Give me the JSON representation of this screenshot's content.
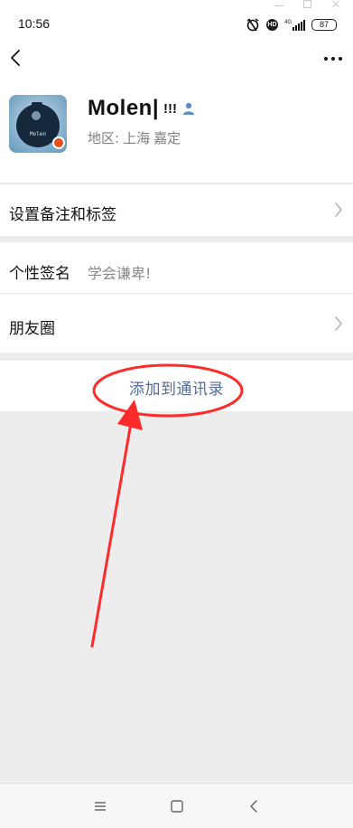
{
  "status_bar": {
    "time": "10:56",
    "hd_label": "HD",
    "network_label": "4G",
    "battery": "87"
  },
  "profile": {
    "avatar_text": "Molen",
    "name": "Molen|",
    "name_extra": "!!!",
    "region_label": "地区:",
    "region_city": "上海",
    "region_district": "嘉定"
  },
  "menu": {
    "remark_tags": "设置备注和标签",
    "signature_label": "个性签名",
    "signature_value": "学会谦卑!",
    "moments": "朋友圈",
    "add_contact": "添加到通讯录"
  },
  "colors": {
    "link": "#576b95",
    "annotation": "#ff2b2b",
    "background": "#ededed"
  },
  "icons": {
    "back": "back-icon",
    "more": "more-icon",
    "gender": "male-icon",
    "chevron": "chevron-right-icon"
  }
}
